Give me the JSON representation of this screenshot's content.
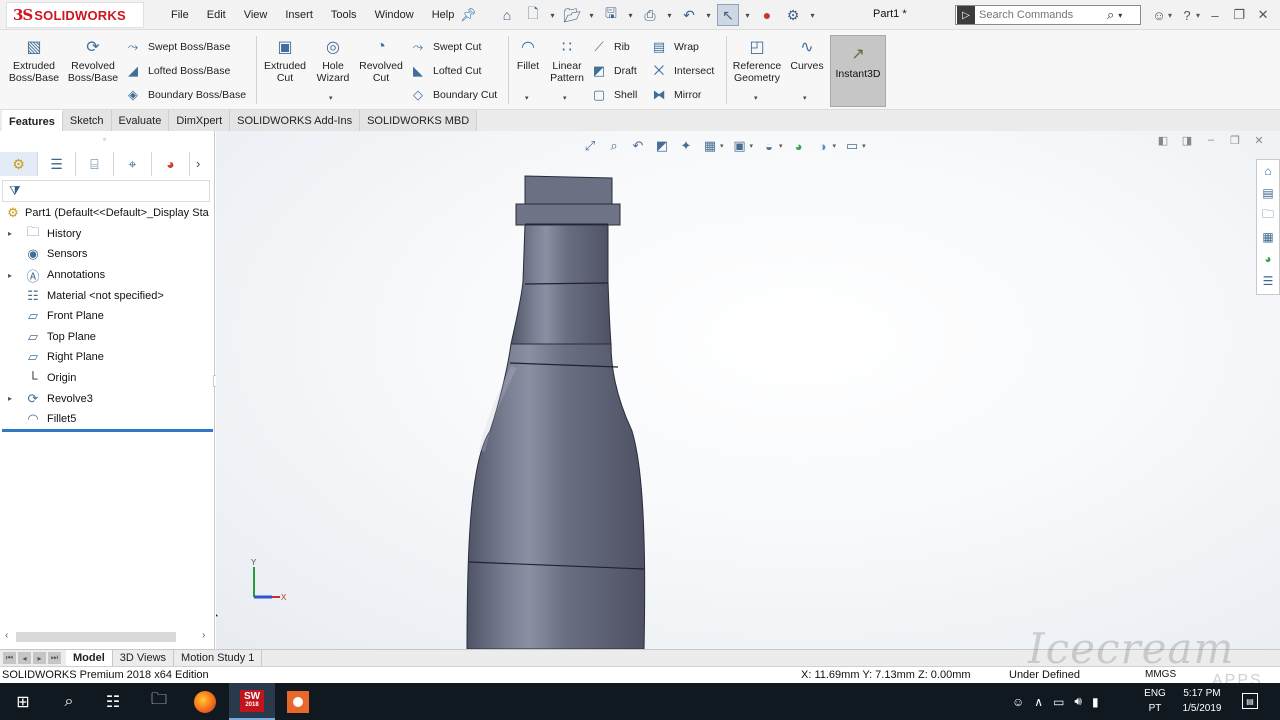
{
  "app": {
    "brand_prefix": "3S",
    "brand_name": "SOLIDWORKS",
    "document_title": "Part1 *"
  },
  "menus": [
    "File",
    "Edit",
    "View",
    "Insert",
    "Tools",
    "Window",
    "Help"
  ],
  "search": {
    "placeholder": "Search Commands"
  },
  "command_manager": {
    "extruded_boss": "Extruded Boss/Base",
    "revolved_boss": "Revolved Boss/Base",
    "swept_boss": "Swept Boss/Base",
    "lofted_boss": "Lofted Boss/Base",
    "boundary_boss": "Boundary Boss/Base",
    "extruded_cut": "Extruded Cut",
    "hole_wizard": "Hole Wizard",
    "revolved_cut": "Revolved Cut",
    "swept_cut": "Swept Cut",
    "lofted_cut": "Lofted Cut",
    "boundary_cut": "Boundary Cut",
    "fillet": "Fillet",
    "linear_pattern": "Linear Pattern",
    "rib": "Rib",
    "draft": "Draft",
    "shell": "Shell",
    "wrap": "Wrap",
    "intersect": "Intersect",
    "mirror": "Mirror",
    "reference_geometry": "Reference Geometry",
    "curves": "Curves",
    "instant3d": "Instant3D"
  },
  "command_tabs": [
    {
      "label": "Features",
      "active": true
    },
    {
      "label": "Sketch",
      "active": false
    },
    {
      "label": "Evaluate",
      "active": false
    },
    {
      "label": "DimXpert",
      "active": false
    },
    {
      "label": "SOLIDWORKS Add-Ins",
      "active": false
    },
    {
      "label": "SOLIDWORKS MBD",
      "active": false
    }
  ],
  "feature_tree": {
    "root": "Part1  (Default<<Default>_Display Sta",
    "items": [
      {
        "label": "History",
        "icon": "history-folder-icon",
        "expandable": true
      },
      {
        "label": "Sensors",
        "icon": "sensors-icon",
        "expandable": false
      },
      {
        "label": "Annotations",
        "icon": "annotations-icon",
        "expandable": true
      },
      {
        "label": "Material <not specified>",
        "icon": "material-icon",
        "expandable": false
      },
      {
        "label": "Front Plane",
        "icon": "plane-icon",
        "expandable": false
      },
      {
        "label": "Top Plane",
        "icon": "plane-icon",
        "expandable": false
      },
      {
        "label": "Right Plane",
        "icon": "plane-icon",
        "expandable": false
      },
      {
        "label": "Origin",
        "icon": "origin-icon",
        "expandable": false
      },
      {
        "label": "Revolve3",
        "icon": "revolve-feature-icon",
        "expandable": true
      },
      {
        "label": "Fillet5",
        "icon": "fillet-feature-icon",
        "expandable": false
      }
    ]
  },
  "triad": {
    "y_label": "Y",
    "x_label": "X"
  },
  "model_tabs": [
    {
      "label": "Model",
      "active": true
    },
    {
      "label": "3D Views",
      "active": false
    },
    {
      "label": "Motion Study 1",
      "active": false
    }
  ],
  "status_bar": {
    "edition": "SOLIDWORKS Premium 2018 x64 Edition",
    "coordinates": "X: 11.69mm Y: 7.13mm Z: 0.00mm",
    "definition": "Under Defined",
    "units": "MMGS"
  },
  "watermark": {
    "line1": "Icecream",
    "line2": "APPS"
  },
  "taskbar": {
    "sw_badge": "SW",
    "sw_year": "2018",
    "language": "ENG",
    "region": "PT",
    "time": "5:17 PM",
    "date": "1/5/2019"
  },
  "colors": {
    "brand_red": "#d0141e",
    "model_body": "#6b6f82",
    "rollback_bar": "#2f78c4",
    "taskbar_bg": "#101820"
  }
}
